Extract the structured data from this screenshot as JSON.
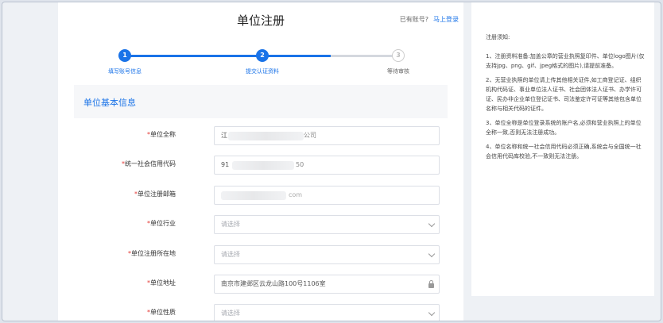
{
  "header": {
    "title": "单位注册",
    "login_hint": "已有账号?",
    "login_link": "马上登录"
  },
  "steps": [
    {
      "number": "1",
      "label": "填写账号信息",
      "state": "done"
    },
    {
      "number": "2",
      "label": "提交认证资料",
      "state": "active"
    },
    {
      "number": "3",
      "label": "等待审核",
      "state": "todo"
    }
  ],
  "section": {
    "title": "单位基本信息"
  },
  "form": {
    "rows": [
      {
        "label": "单位全称",
        "value": "江",
        "value_suffix": "公司",
        "blurred": true
      },
      {
        "label": "统一社会信用代码",
        "value": "91",
        "value_suffix": "50",
        "blurred": true
      },
      {
        "label": "单位注册邮箱",
        "value": "",
        "value_suffix": "com",
        "blurred": true
      },
      {
        "label": "单位行业",
        "value": "",
        "placeholder": "请选择"
      },
      {
        "label": "单位注册所在地",
        "value": "",
        "placeholder": "请选择"
      },
      {
        "label": "单位地址",
        "value": "南京市建邺区云龙山路100号1106室"
      },
      {
        "label": "单位性质",
        "value": "",
        "placeholder": "请选择"
      }
    ],
    "required_mark": "*"
  },
  "notice": {
    "title": "注册须知:",
    "items": [
      "1、注册资料准备:加盖公章的营业执照复印件、单位logo图片(仅支持jpg、png、gif、jpeg格式的图片),请提前准备。",
      "2、无营业执照的单位请上传其他相关证件,如工商登记证、组织机构代码证、事业单位法人证书、社会团体法人证书、办学许可证、民办非企业单位登记证书、司法鉴定许可证等其他包含单位名称与相关代码的证件。",
      "3、单位全称是单位登录系统的账户名,必须和营业执照上的单位全称一致,否则无法注册成功。",
      "4、单位名称和统一社会信用代码必须正确,系统会与全国统一社会信用代码库校验,不一致则无法注册。"
    ]
  },
  "colors": {
    "accent": "#1a73e8",
    "required": "#e53935",
    "background": "#dfe4ec"
  }
}
